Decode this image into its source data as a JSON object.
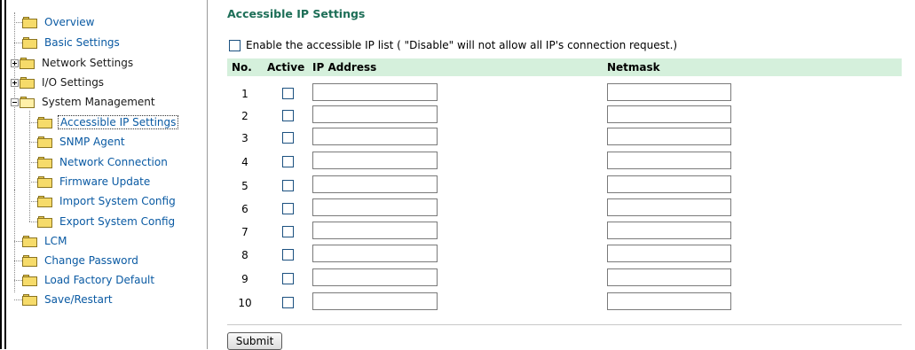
{
  "sidebar": {
    "items": [
      {
        "label": "Overview"
      },
      {
        "label": "Basic Settings"
      },
      {
        "label": "Network Settings"
      },
      {
        "label": "I/O Settings"
      },
      {
        "label": "System Management"
      },
      {
        "label": "Accessible IP Settings"
      },
      {
        "label": "SNMP Agent"
      },
      {
        "label": "Network Connection"
      },
      {
        "label": "Firmware Update"
      },
      {
        "label": "Import System Config"
      },
      {
        "label": "Export System Config"
      },
      {
        "label": "LCM"
      },
      {
        "label": "Change Password"
      },
      {
        "label": "Load Factory Default"
      },
      {
        "label": "Save/Restart"
      }
    ]
  },
  "main": {
    "title": "Accessible IP Settings",
    "enable_label": "Enable the accessible IP list ( \"Disable\" will not allow all IP's connection request.)",
    "enable_checked": false,
    "columns": {
      "no": "No.",
      "active": "Active",
      "ip": "IP Address",
      "netmask": "Netmask"
    },
    "rows": [
      {
        "no": "1",
        "active": false,
        "ip": "",
        "netmask": ""
      },
      {
        "no": "2",
        "active": false,
        "ip": "",
        "netmask": ""
      },
      {
        "no": "3",
        "active": false,
        "ip": "",
        "netmask": ""
      },
      {
        "no": "4",
        "active": false,
        "ip": "",
        "netmask": ""
      },
      {
        "no": "5",
        "active": false,
        "ip": "",
        "netmask": ""
      },
      {
        "no": "6",
        "active": false,
        "ip": "",
        "netmask": ""
      },
      {
        "no": "7",
        "active": false,
        "ip": "",
        "netmask": ""
      },
      {
        "no": "8",
        "active": false,
        "ip": "",
        "netmask": ""
      },
      {
        "no": "9",
        "active": false,
        "ip": "",
        "netmask": ""
      },
      {
        "no": "10",
        "active": false,
        "ip": "",
        "netmask": ""
      }
    ],
    "submit_label": "Submit"
  }
}
